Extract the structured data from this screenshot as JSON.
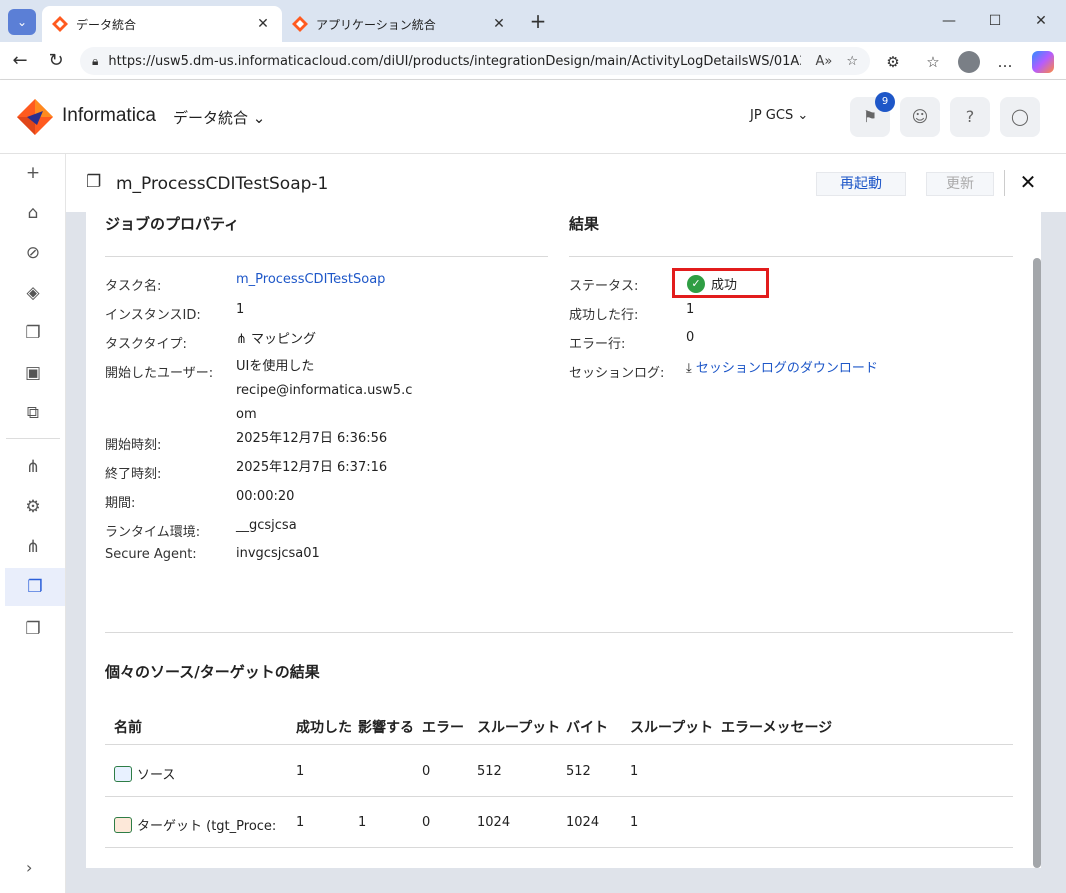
{
  "browser": {
    "tabs": [
      {
        "title": "データ統合",
        "active": true
      },
      {
        "title": "アプリケーション統合",
        "active": false
      }
    ],
    "url": "https://usw5.dm-us.informaticacloud.com/diUI/products/integrationDesign/main/ActivityLogDetailsWS/01A26...",
    "window_controls": [
      "minimize",
      "maximize",
      "close"
    ]
  },
  "header": {
    "brand": "Informatica",
    "product": "データ統合",
    "org": "JP GCS",
    "notification_count": "9"
  },
  "page": {
    "title": "m_ProcessCDITestSoap-1",
    "restart_label": "再起動",
    "refresh_label": "更新"
  },
  "job_properties": {
    "title": "ジョブのプロパティ",
    "rows": [
      {
        "label": "タスク名:",
        "value": "m_ProcessCDITestSoap"
      },
      {
        "label": "インスタンスID:",
        "value": "1"
      },
      {
        "label": "タスクタイプ:",
        "value": "マッピング"
      },
      {
        "label": "開始したユーザー:",
        "value_lines": [
          "UIを使用した",
          "recipe@informatica.usw5.c",
          "om"
        ]
      },
      {
        "label": "開始時刻:",
        "value": "2025年12月7日 6:36:56"
      },
      {
        "label": "終了時刻:",
        "value": "2025年12月7日 6:37:16"
      },
      {
        "label": "期間:",
        "value": "00:00:20"
      },
      {
        "label": "ランタイム環境:",
        "value": "__gcsjcsa"
      },
      {
        "label": "Secure Agent:",
        "value": "invgcsjcsa01"
      }
    ]
  },
  "results": {
    "title": "結果",
    "status_label": "ステータス:",
    "status_value": "成功",
    "success_rows_label": "成功した行:",
    "success_rows_value": "1",
    "error_rows_label": "エラー行:",
    "error_rows_value": "0",
    "session_log_label": "セッションログ:",
    "session_log_link": "セッションログのダウンロード"
  },
  "individual": {
    "title": "個々のソース/ターゲットの結果",
    "columns": [
      "名前",
      "成功した",
      "影響する",
      "エラー",
      "スループット",
      "バイト",
      "スループット",
      "エラーメッセージ"
    ],
    "rows": [
      {
        "name": "ソース",
        "success": "1",
        "affected": "",
        "errors": "0",
        "throughput": "512",
        "bytes": "512",
        "throughput2": "1",
        "message": ""
      },
      {
        "name": "ターゲット (tgt_Proce:",
        "success": "1",
        "affected": "1",
        "errors": "0",
        "throughput": "1024",
        "bytes": "1024",
        "throughput2": "1",
        "message": ""
      }
    ]
  },
  "colors": {
    "accent": "#1e57c8",
    "success": "#2f9e44",
    "highlight_box": "#e21c1c"
  }
}
